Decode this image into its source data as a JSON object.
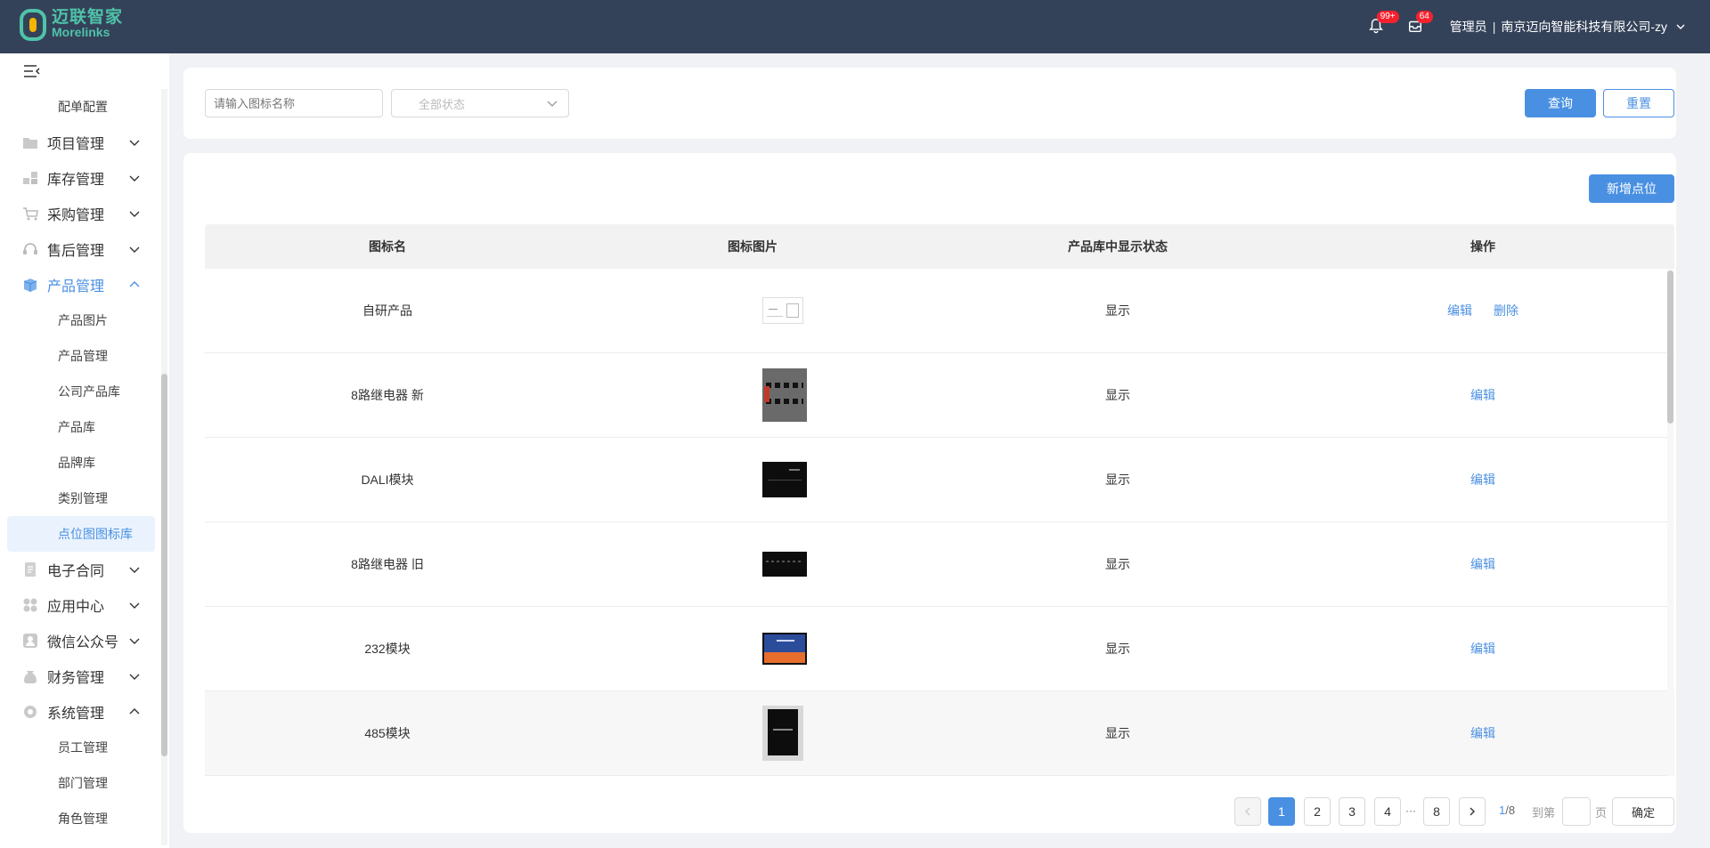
{
  "header": {
    "logo_cn": "迈联智家",
    "logo_en": "Morelinks",
    "notify_badge": "99+",
    "message_badge": "64",
    "user_role": "管理员",
    "separator": "|",
    "company": "南京迈向智能科技有限公司-zy"
  },
  "sidebar": {
    "items": [
      {
        "type": "sub",
        "label": "配单配置"
      },
      {
        "type": "main",
        "label": "项目管理",
        "icon": "folder-icon",
        "expanded": false
      },
      {
        "type": "main",
        "label": "库存管理",
        "icon": "inventory-icon",
        "expanded": false
      },
      {
        "type": "main",
        "label": "采购管理",
        "icon": "cart-icon",
        "expanded": false
      },
      {
        "type": "main",
        "label": "售后管理",
        "icon": "headset-icon",
        "expanded": false
      },
      {
        "type": "main",
        "label": "产品管理",
        "icon": "box-icon",
        "expanded": true,
        "active": true
      },
      {
        "type": "sub",
        "label": "产品图片"
      },
      {
        "type": "sub",
        "label": "产品管理"
      },
      {
        "type": "sub",
        "label": "公司产品库"
      },
      {
        "type": "sub",
        "label": "产品库"
      },
      {
        "type": "sub",
        "label": "品牌库"
      },
      {
        "type": "sub",
        "label": "类别管理"
      },
      {
        "type": "sub",
        "label": "点位图图标库",
        "selected": true
      },
      {
        "type": "main",
        "label": "电子合同",
        "icon": "contract-icon",
        "expanded": false
      },
      {
        "type": "main",
        "label": "应用中心",
        "icon": "apps-icon",
        "expanded": false
      },
      {
        "type": "main",
        "label": "微信公众号",
        "icon": "wechat-icon",
        "expanded": false
      },
      {
        "type": "main",
        "label": "财务管理",
        "icon": "finance-icon",
        "expanded": false
      },
      {
        "type": "main",
        "label": "系统管理",
        "icon": "system-icon",
        "expanded": true
      },
      {
        "type": "sub",
        "label": "员工管理"
      },
      {
        "type": "sub",
        "label": "部门管理"
      },
      {
        "type": "sub",
        "label": "角色管理"
      }
    ]
  },
  "search": {
    "name_placeholder": "请输入图标名称",
    "status_selected": "全部状态",
    "query_label": "查询",
    "reset_label": "重置"
  },
  "toolbar": {
    "add_label": "新增点位"
  },
  "table": {
    "headers": [
      "图标名",
      "图标图片",
      "产品库中显示状态",
      "操作"
    ],
    "rows": [
      {
        "name": "自研产品",
        "image": "drawing",
        "status": "显示",
        "actions": [
          "编辑",
          "删除"
        ]
      },
      {
        "name": "8路继电器 新",
        "image": "relay-new",
        "status": "显示",
        "actions": [
          "编辑"
        ]
      },
      {
        "name": "DALI模块",
        "image": "dali",
        "status": "显示",
        "actions": [
          "编辑"
        ]
      },
      {
        "name": "8路继电器 旧",
        "image": "relay-old",
        "status": "显示",
        "actions": [
          "编辑"
        ]
      },
      {
        "name": "232模块",
        "image": "m232",
        "status": "显示",
        "actions": [
          "编辑"
        ]
      },
      {
        "name": "485模块",
        "image": "m485",
        "status": "显示",
        "actions": [
          "编辑"
        ]
      }
    ]
  },
  "pagination": {
    "pages": [
      "1",
      "2",
      "3",
      "4"
    ],
    "ellipsis": "···",
    "last": "8",
    "current_page": "1",
    "total_pages": "/8",
    "goto_label": "到第",
    "page_unit": "页",
    "confirm_label": "确定"
  },
  "colors": {
    "header_bg": "#344259",
    "accent": "#4a90e2",
    "logo": "#4fc3a9",
    "badge": "#f5222d"
  }
}
